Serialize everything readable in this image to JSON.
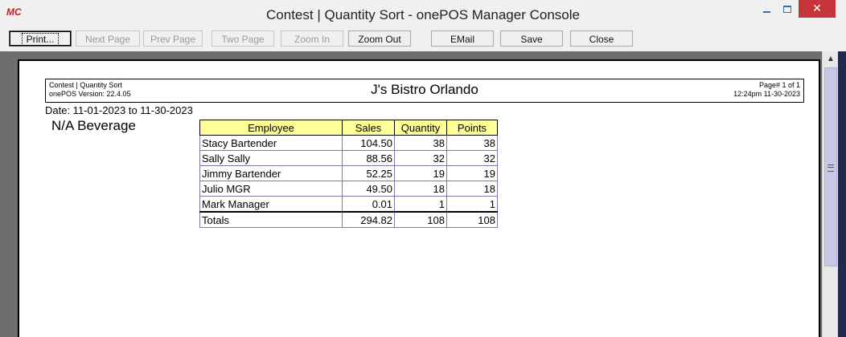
{
  "window": {
    "logo": "MC",
    "title": "Contest | Quantity Sort - onePOS Manager Console",
    "close_glyph": "✕"
  },
  "toolbar": {
    "print": "Print...",
    "next_page": "Next Page",
    "prev_page": "Prev Page",
    "two_page": "Two Page",
    "zoom_in": "Zoom In",
    "zoom_out": "Zoom Out",
    "email": "EMail",
    "save": "Save",
    "close": "Close"
  },
  "report": {
    "header_left_line1": "Contest | Quantity Sort",
    "header_left_line2": "onePOS Version: 22.4.05",
    "header_center": "J's Bistro Orlando",
    "header_right_line1": "Page#  1 of  1",
    "header_right_line2": "12:24pm 11-30-2023",
    "date_range": "Date: 11-01-2023 to 11-30-2023",
    "category": "N/A Beverage",
    "columns": [
      "Employee",
      "Sales",
      "Quantity",
      "Points"
    ],
    "rows": [
      [
        "Stacy Bartender",
        "104.50",
        "38",
        "38"
      ],
      [
        "Sally Sally",
        "88.56",
        "32",
        "32"
      ],
      [
        "Jimmy Bartender",
        "52.25",
        "19",
        "19"
      ],
      [
        "Julio MGR",
        "49.50",
        "18",
        "18"
      ],
      [
        "Mark Manager",
        "0.01",
        "1",
        "1"
      ]
    ],
    "totals": [
      "Totals",
      "294.82",
      "108",
      "108"
    ]
  },
  "scrollbar": {
    "up_glyph": "▲"
  },
  "colors": {
    "header_fill": "#ffff9a",
    "close_button": "#c6353b",
    "logo": "#c8182a"
  }
}
